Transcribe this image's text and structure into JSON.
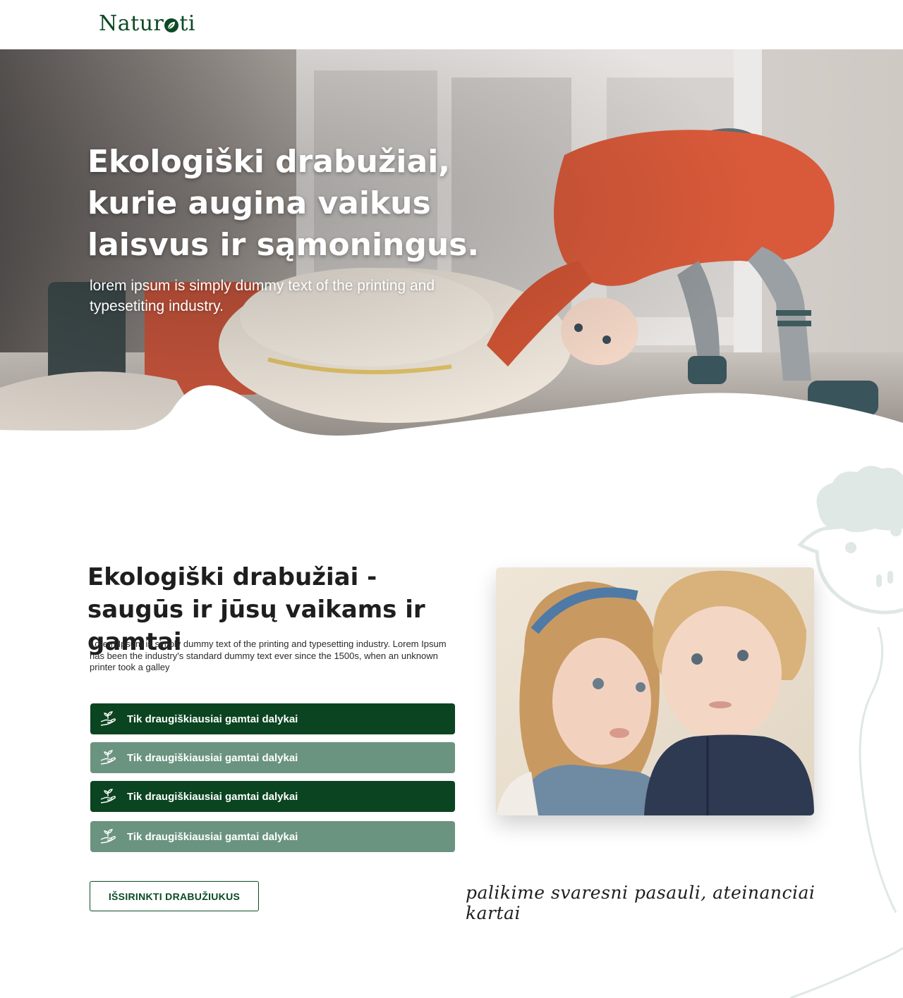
{
  "header": {
    "logo_text_start": "Natur",
    "logo_text_end": "ti"
  },
  "hero": {
    "title": "Ekologiški drabužiai, kurie augina vaikus laisvus ir sąmoningus.",
    "subtitle": "lorem ipsum is simply dummy text of the printing and typesetiting industry."
  },
  "section": {
    "title": "Ekologiški drabužiai - saugūs ir jūsų vaikams ir gamtai",
    "text": "Lorem Ipsum is simply dummy text of the printing and typesetting industry. Lorem Ipsum has been the industry's standard dummy text ever since the 1500s, when an unknown printer took a galley",
    "features": [
      {
        "label": "Tik draugiškiausiai gamtai dalykai",
        "icon": "plant-hand-icon",
        "style": "dark"
      },
      {
        "label": "Tik draugiškiausiai gamtai dalykai",
        "icon": "plant-hand-icon",
        "style": "light"
      },
      {
        "label": "Tik draugiškiausiai gamtai dalykai",
        "icon": "plant-hand-icon",
        "style": "dark"
      },
      {
        "label": "Tik draugiškiausiai gamtai dalykai",
        "icon": "plant-hand-icon",
        "style": "light"
      }
    ],
    "cta_label": "IŠSIRINKTI DRABUŽIUKUS",
    "tagline": "palikime svaresni pasauli, ateinanciai kartai"
  },
  "colors": {
    "brand_dark": "#0a4420",
    "brand_light": "#6b9480",
    "sheep_outline": "#dfe8e4"
  }
}
